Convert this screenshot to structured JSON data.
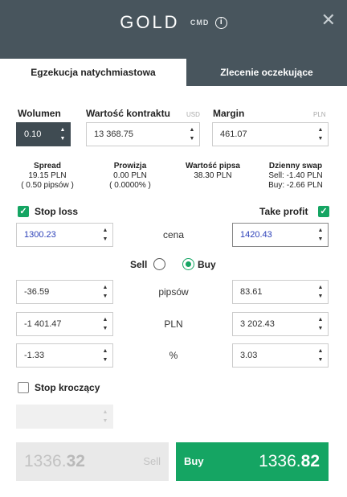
{
  "header": {
    "symbol": "GOLD",
    "tag": "CMD",
    "info_glyph": "i",
    "close_glyph": "✕"
  },
  "tabs": {
    "instant": "Egzekucja natychmiastowa",
    "pending": "Zlecenie oczekujące"
  },
  "volume": {
    "label": "Wolumen",
    "value": "0.10"
  },
  "contract": {
    "label": "Wartość kontraktu",
    "unit": "USD",
    "value": "13 368.75"
  },
  "margin": {
    "label": "Margin",
    "unit": "PLN",
    "value": "461.07"
  },
  "stats": {
    "spread": {
      "title": "Spread",
      "line1": "19.15 PLN",
      "line2": "( 0.50 pipsów )"
    },
    "commission": {
      "title": "Prowizja",
      "line1": "0.00 PLN",
      "line2": "( 0.0000% )"
    },
    "pip_value": {
      "title": "Wartość pipsa",
      "line1": "38.30 PLN"
    },
    "swap": {
      "title": "Dzienny swap",
      "line1": "Sell: -1.40 PLN",
      "line2": "Buy: -2.66 PLN"
    }
  },
  "stop_loss": {
    "label": "Stop loss",
    "checked": true,
    "price": "1300.23",
    "pips": "-36.59",
    "pln": "-1 401.47",
    "percent": "-1.33"
  },
  "take_profit": {
    "label": "Take profit",
    "checked": true,
    "price": "1420.43",
    "pips": "83.61",
    "pln": "3 202.43",
    "percent": "3.03"
  },
  "rows": {
    "price_label": "cena",
    "pips_label": "pipsów",
    "pln_label": "PLN",
    "percent_label": "%"
  },
  "direction": {
    "sell_label": "Sell",
    "buy_label": "Buy",
    "selected": "Buy"
  },
  "trailing_stop": {
    "label": "Stop kroczący",
    "checked": false
  },
  "sell_button": {
    "price_main": "1336.",
    "price_big": "32",
    "label": "Sell"
  },
  "buy_button": {
    "label": "Buy",
    "price_main": "1336.",
    "price_big": "82"
  },
  "colors": {
    "header": "#48555d",
    "accent_green": "#15a563",
    "input_text_blue": "#2b3fb8"
  }
}
